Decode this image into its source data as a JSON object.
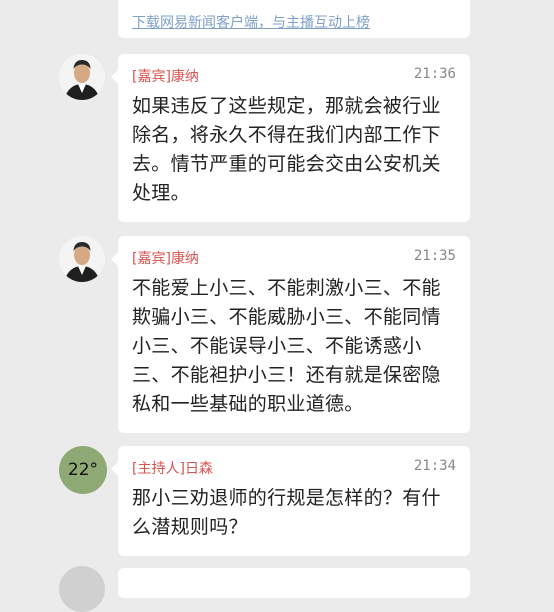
{
  "top_banner": {
    "link_text": "下载网易新闻客户端，与主播互动上榜"
  },
  "messages": [
    {
      "role_tag": "[嘉宾]",
      "name": "康纳",
      "time": "21:36",
      "text": "如果违反了这些规定，那就会被行业除名，将永久不得在我们内部工作下去。情节严重的可能会交由公安机关处理。",
      "avatar": "person-photo"
    },
    {
      "role_tag": "[嘉宾]",
      "name": "康纳",
      "time": "21:35",
      "text": "不能爱上小三、不能刺激小三、不能欺骗小三、不能威胁小三、不能同情小三、不能误导小三、不能诱惑小三、不能袒护小三！还有就是保密隐私和一些基础的职业道德。",
      "avatar": "person-photo"
    },
    {
      "role_tag": "[主持人]",
      "name": "日森",
      "time": "21:34",
      "text": "那小三劝退师的行规是怎样的？有什么潜规则吗？",
      "avatar": "weather-badge",
      "avatar_text": "22°"
    }
  ],
  "colors": {
    "background": "#ebebeb",
    "bubble": "#ffffff",
    "speaker": "#d9534f",
    "link": "#7f9fc9",
    "weather_avatar": "#8ea974"
  }
}
